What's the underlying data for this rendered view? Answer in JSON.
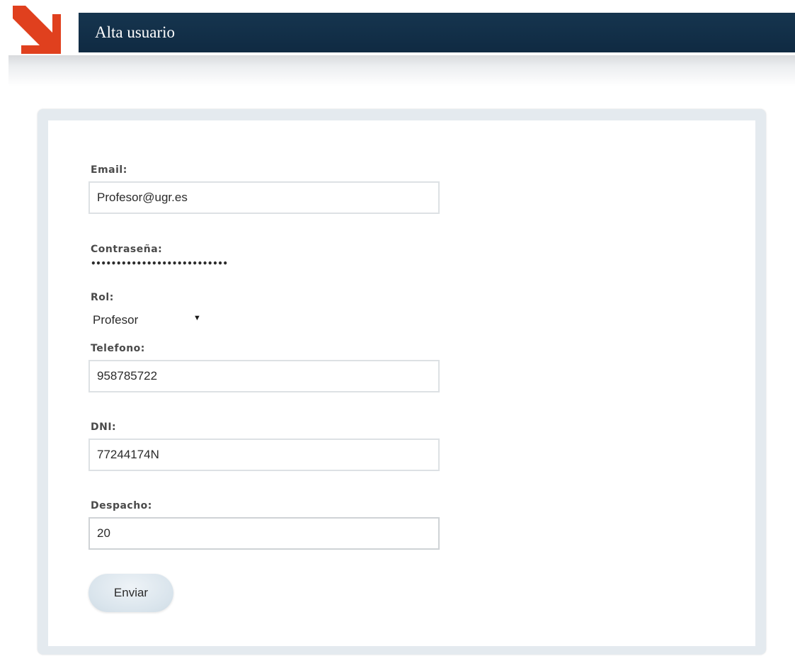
{
  "header": {
    "title": "Alta usuario"
  },
  "form": {
    "email": {
      "label": "Email:",
      "value": "Profesor@ugr.es"
    },
    "password": {
      "label": "Contraseña:",
      "masked_value": "•••••••••••••••••••••••••••"
    },
    "rol": {
      "label": "Rol:",
      "selected": "Profesor"
    },
    "telefono": {
      "label": "Telefono:",
      "value": "958785722"
    },
    "dni": {
      "label": "DNI:",
      "value": "77244174N"
    },
    "despacho": {
      "label": "Despacho:",
      "value": "20"
    },
    "submit_label": "Enviar"
  },
  "icons": {
    "logo": "arrow-down-right-icon",
    "select_arrow": "dropdown-arrow-icon"
  },
  "colors": {
    "header_bg": "#12304a",
    "logo": "#e0401e",
    "card_border": "#e4eaef",
    "button_bg": "#dae5ed"
  }
}
